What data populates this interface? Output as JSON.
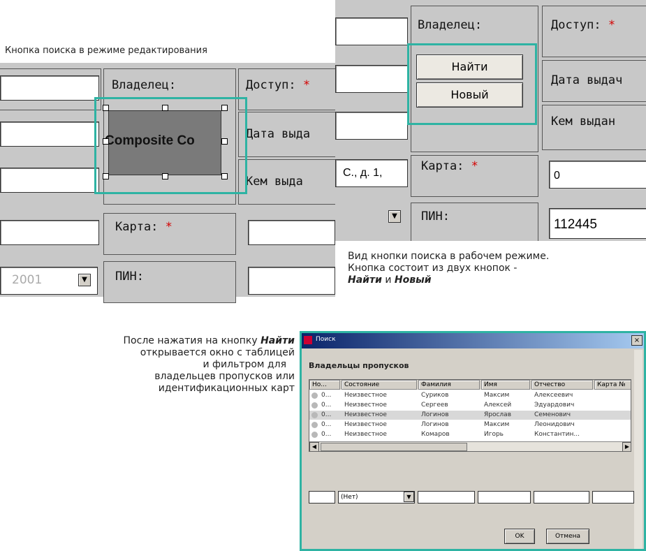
{
  "edit_mode": {
    "caption": "Кнопка поиска в режиме редактирования",
    "owner_label": "Владелец:",
    "access_label": "Доступ:",
    "required_mark": "*",
    "composite_label": "Composite Co",
    "issue_date_label": "Дата выда",
    "issued_by_label": "Кем выда",
    "card_label": "Карта:",
    "pin_label": "ПИН:",
    "year_value": "2001"
  },
  "work_mode": {
    "owner_label": "Владелец:",
    "access_label": "Доступ:",
    "required_mark": "*",
    "find_button": "Найти",
    "new_button": "Новый",
    "issue_date_label": "Дата выдач",
    "issued_by_label": "Кем выдан",
    "address_fragment": "С., д. 1,",
    "card_label": "Карта:",
    "card_value": "0",
    "pin_label": "ПИН:",
    "pin_value": "112445",
    "caption_line1": "Вид кнопки поиска в рабочем режиме.",
    "caption_line2": "Кнопка состоит из двух кнопок -",
    "caption_find": "Найти",
    "caption_and": "и",
    "caption_new": "Новый"
  },
  "search_caption": {
    "line1_prefix": "После нажатия на кнопку",
    "line1_bold": "Найти",
    "line2": "открывается окно с таблицей",
    "line3": "и фильтром для",
    "line4": "владельцев пропусков или",
    "line5": "идентификационных карт"
  },
  "dialog": {
    "title": "Поиск",
    "heading": "Владельцы пропусков",
    "columns": [
      "Но...",
      "Состояние",
      "Фамилия",
      "Имя",
      "Отчество",
      "Карта №"
    ],
    "rows": [
      [
        "0...",
        "Неизвестное",
        "Суриков",
        "Максим",
        "Алексеевич",
        ""
      ],
      [
        "0...",
        "Неизвестное",
        "Сергеев",
        "Алексей",
        "Эдуардович",
        ""
      ],
      [
        "0...",
        "Неизвестное",
        "Логинов",
        "Ярослав",
        "Семенович",
        ""
      ],
      [
        "0...",
        "Неизвестное",
        "Логинов",
        "Максим",
        "Леонидович",
        ""
      ],
      [
        "0...",
        "Неизвестное",
        "Комаров",
        "Игорь",
        "Константин...",
        ""
      ]
    ],
    "filter_value": "(Нет)",
    "ok_button": "OK",
    "cancel_button": "Отмена"
  }
}
